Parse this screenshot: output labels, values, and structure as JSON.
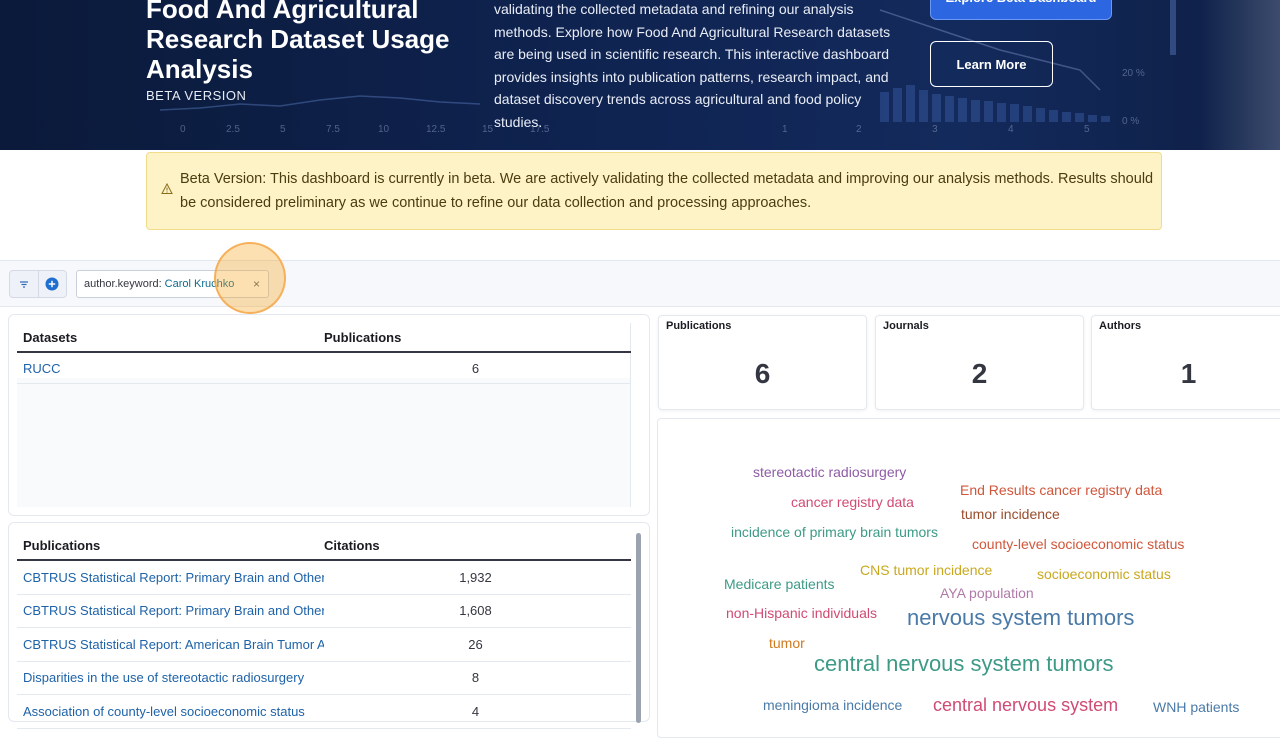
{
  "hero": {
    "title": "Food And Agricultural Research Dataset Usage Analysis",
    "subtitle": "BETA VERSION",
    "description": "validating the collected metadata and refining our analysis methods. Explore how Food And Agricultural Research datasets are being used in scientific research. This interactive dashboard provides insights into publication patterns, research impact, and dataset discovery trends across agricultural and food policy studies.",
    "explore_label": "Explore Beta Dashboard",
    "learn_label": "Learn More",
    "bg_ticks_left": [
      "0",
      "2.5",
      "5",
      "7.5",
      "10",
      "12.5",
      "15",
      "17.5"
    ],
    "bg_ticks_right": [
      "1",
      "2",
      "3",
      "4",
      "5"
    ],
    "bg_pct": [
      "20 %",
      "0 %"
    ]
  },
  "notice": {
    "text": "Beta Version: This dashboard is currently in beta. We are actively validating the collected metadata and improving our analysis methods. Results should be considered preliminary as we continue to refine our data collection and processing approaches."
  },
  "filter": {
    "key": "author.keyword:",
    "value": "Carol Kruchko",
    "remove": "×"
  },
  "datasets_table": {
    "headers": [
      "Datasets",
      "Publications"
    ],
    "rows": [
      [
        "RUCC",
        "6"
      ]
    ]
  },
  "publications_table": {
    "headers": [
      "Publications",
      "Citations"
    ],
    "rows": [
      [
        "CBTRUS Statistical Report: Primary Brain and Other Central Nervous System Tumors",
        "1,932"
      ],
      [
        "CBTRUS Statistical Report: Primary Brain and Other Central Nervous System Tumors",
        "1,608"
      ],
      [
        "CBTRUS Statistical Report: American Brain Tumor Association",
        "26"
      ],
      [
        "Disparities in the use of stereotactic radiosurgery",
        "8"
      ],
      [
        "Association of county-level socioeconomic status",
        "4"
      ]
    ]
  },
  "stats": [
    {
      "label": "Publications",
      "value": "6"
    },
    {
      "label": "Journals",
      "value": "2"
    },
    {
      "label": "Authors",
      "value": "1"
    }
  ],
  "word_cloud": [
    {
      "text": "stereotactic radiosurgery",
      "color": "#8e5ba6"
    },
    {
      "text": "End Results cancer registry data",
      "color": "#d0563b"
    },
    {
      "text": "cancer registry data",
      "color": "#d04b73"
    },
    {
      "text": "tumor incidence",
      "color": "#9a4c2b"
    },
    {
      "text": "incidence of primary brain tumors",
      "color": "#3d9a86"
    },
    {
      "text": "county-level socioeconomic status",
      "color": "#d0563b"
    },
    {
      "text": "CNS tumor incidence",
      "color": "#c9a81e"
    },
    {
      "text": "Medicare patients",
      "color": "#3d9a86"
    },
    {
      "text": "socioeconomic status",
      "color": "#c9a81e"
    },
    {
      "text": "AYA population",
      "color": "#b07aa8"
    },
    {
      "text": "non-Hispanic individuals",
      "color": "#d04b73"
    },
    {
      "text": "nervous system tumors",
      "color": "#4a7aa8"
    },
    {
      "text": "tumor",
      "color": "#d07a1e"
    },
    {
      "text": "central nervous system tumors",
      "color": "#3d9a86"
    },
    {
      "text": "meningioma incidence",
      "color": "#4a7aa8"
    },
    {
      "text": "central nervous system",
      "color": "#d04b73"
    },
    {
      "text": "WNH patients",
      "color": "#4a7aa8"
    }
  ]
}
